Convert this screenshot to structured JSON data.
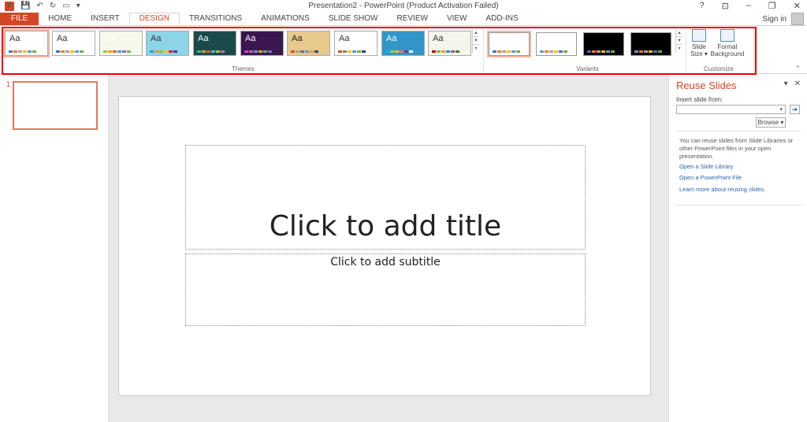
{
  "window": {
    "title": "Presentation2 - PowerPoint (Product Activation Failed)",
    "buttons": [
      "?",
      "⊡",
      "–",
      "❐",
      "✕"
    ],
    "signin": "Sign in"
  },
  "qat": {
    "logo": "P"
  },
  "tabs": [
    "FILE",
    "HOME",
    "INSERT",
    "DESIGN",
    "TRANSITIONS",
    "ANIMATIONS",
    "SLIDE SHOW",
    "REVIEW",
    "VIEW",
    "ADD-INS"
  ],
  "active_tab": "DESIGN",
  "ribbon": {
    "themes_label": "Themes",
    "variants_label": "Variants",
    "customize_label": "Customize",
    "theme_aa": "Aa",
    "slide_size_label": "Slide\nSize ▾",
    "format_bg_label": "Format\nBackground",
    "themes": [
      {
        "bg": "#ffffff",
        "fg": "#333333",
        "colors": [
          "#4472c4",
          "#ed7d31",
          "#a5a5a5",
          "#ffc000",
          "#5b9bd5",
          "#70ad47"
        ]
      },
      {
        "bg": "#ffffff",
        "fg": "#333333",
        "colors": [
          "#4472c4",
          "#ed7d31",
          "#a5a5a5",
          "#ffc000",
          "#5b9bd5",
          "#70ad47"
        ]
      },
      {
        "bg": "#f4f9ec",
        "fg": "#ffffff",
        "colors": [
          "#8cc63f",
          "#f4a300",
          "#e0603f",
          "#3aa6dd",
          "#a06bb4",
          "#6bbd45"
        ]
      },
      {
        "bg": "#8dd4e8",
        "fg": "#333333",
        "colors": [
          "#2e9bd6",
          "#f7941d",
          "#8dc63f",
          "#ffc20e",
          "#ed1c24",
          "#662d91"
        ]
      },
      {
        "bg": "#1b4a4a",
        "fg": "#ffffff",
        "colors": [
          "#1bc3a5",
          "#d6a03a",
          "#e4543a",
          "#5fb6d6",
          "#a3c940",
          "#c76fb0"
        ]
      },
      {
        "bg": "#3b1750",
        "fg": "#ffffff",
        "colors": [
          "#b94ad9",
          "#e0519c",
          "#4ba3dc",
          "#ff9d2b",
          "#53bd6a",
          "#8a6cc8"
        ]
      },
      {
        "bg": "#e7c98c",
        "fg": "#222222",
        "colors": [
          "#c0504d",
          "#9bbb59",
          "#8064a2",
          "#4bacc6",
          "#f79646",
          "#2c4d75"
        ]
      },
      {
        "bg": "#ffffff",
        "fg": "#333333",
        "colors": [
          "#c65911",
          "#7f7f7f",
          "#ffc000",
          "#5b9bd5",
          "#70ad47",
          "#264478"
        ]
      },
      {
        "bg": "#3296c8",
        "fg": "#ffffff",
        "colors": [
          "#00b0f0",
          "#92d050",
          "#ffc000",
          "#ff6f61",
          "#7030a0",
          "#ffffff"
        ]
      },
      {
        "bg": "#f3f6ea",
        "fg": "#333333",
        "colors": [
          "#c00000",
          "#8db33a",
          "#e6a020",
          "#3a88c0",
          "#8064a2",
          "#4e7a2e"
        ]
      }
    ],
    "variants": [
      {
        "bg": "#ffffff",
        "colors": [
          "#4472c4",
          "#ed7d31",
          "#a5a5a5",
          "#ffc000",
          "#5b9bd5",
          "#70ad47"
        ]
      },
      {
        "bg": "#ffffff",
        "colors": [
          "#5b9bd5",
          "#ed7d31",
          "#a5a5a5",
          "#ffc000",
          "#4472c4",
          "#70ad47"
        ]
      },
      {
        "bg": "#000000",
        "colors": [
          "#4472c4",
          "#ed7d31",
          "#a5a5a5",
          "#ffc000",
          "#5b9bd5",
          "#70ad47"
        ]
      },
      {
        "bg": "#000000",
        "colors": [
          "#5b9bd5",
          "#ed7d31",
          "#a5a5a5",
          "#ffc000",
          "#4472c4",
          "#70ad47"
        ]
      }
    ]
  },
  "thumbnails": {
    "number": "1"
  },
  "slide": {
    "title_placeholder": "Click to add title",
    "subtitle_placeholder": "Click to add subtitle"
  },
  "reuse": {
    "title": "Reuse Slides",
    "insert_from_label": "Insert slide from:",
    "combo_arrow": "▾",
    "go": "➔",
    "browse": "Browse ▾",
    "description": "You can reuse slides from Slide Libraries or other PowerPoint files in your open presentation.",
    "link_library": "Open a Slide Library",
    "link_file": "Open a PowerPoint File",
    "link_learn": "Learn more about reusing slides."
  }
}
